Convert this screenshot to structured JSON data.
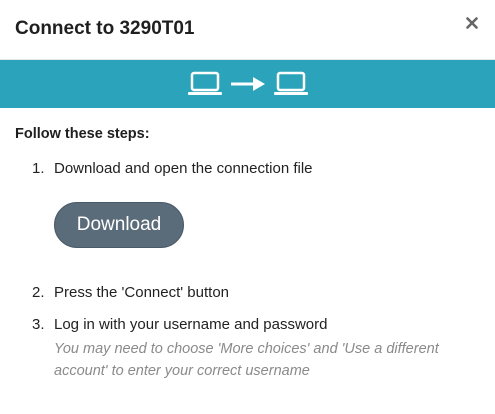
{
  "dialog": {
    "title": "Connect to 3290T01",
    "close_icon": "close-icon"
  },
  "banner": {
    "background_color": "#2aa3bb",
    "icons": [
      "laptop-icon",
      "arrow-right-icon",
      "laptop-icon"
    ]
  },
  "content": {
    "heading": "Follow these steps:",
    "steps": [
      {
        "number": "1.",
        "text": "Download and open the connection file"
      },
      {
        "number": "2.",
        "text": "Press the 'Connect' button"
      },
      {
        "number": "3.",
        "text": "Log in with your username and password",
        "hint": "You may need to choose 'More choices' and 'Use a different account' to enter your correct username"
      }
    ],
    "download_button_label": "Download",
    "download_button_color": "#5a6b7a"
  }
}
